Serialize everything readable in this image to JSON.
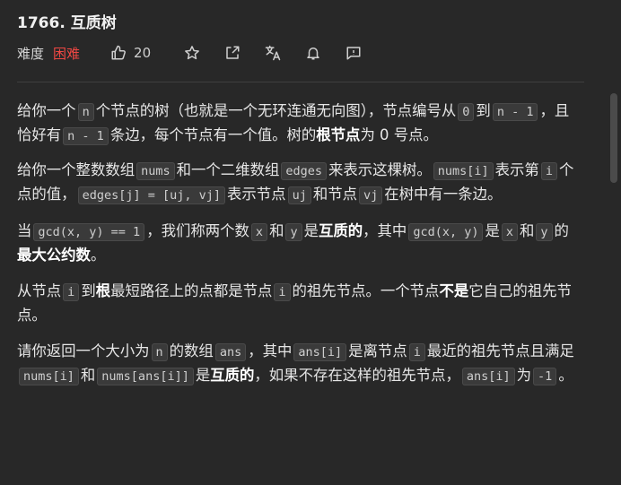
{
  "problem": {
    "title": "1766. 互质树",
    "difficulty_label": "难度",
    "difficulty": "困难",
    "likes": "20"
  },
  "icons": [
    "thumbs-up-icon",
    "star-icon",
    "share-icon",
    "translate-icon",
    "bell-icon",
    "feedback-icon"
  ],
  "colors": {
    "difficulty_hard": "#ef4743",
    "background": "#282828"
  },
  "desc": {
    "p1": {
      "t1": "给你一个",
      "c1": "n",
      "t2": "个节点的树（也就是一个无环连通无向图），节点编号从",
      "c2": "0",
      "t3": "到",
      "c3": "n - 1",
      "t4": "，且恰好有",
      "c4": "n - 1",
      "t5": "条边，每个节点有一个值。树的",
      "b1": "根节点",
      "t6": "为 0 号点。"
    },
    "p2": {
      "t1": "给你一个整数数组",
      "c1": "nums",
      "t2": "和一个二维数组",
      "c2": "edges",
      "t3": "来表示这棵树。",
      "c3": "nums[i]",
      "t4": "表示第",
      "c4": "i",
      "t5": "个点的值，",
      "c5": "edges[j] = [uj, vj]",
      "t6": "表示节点",
      "c6": "uj",
      "t7": "和节点",
      "c7": "vj",
      "t8": "在树中有一条边。"
    },
    "p3": {
      "t1": "当",
      "c1": "gcd(x, y) == 1",
      "t2": "，我们称两个数",
      "c2": "x",
      "t3": "和",
      "c3": "y",
      "t4": "是",
      "b1": "互质的",
      "t5": "，其中",
      "c4": "gcd(x, y)",
      "t6": "是",
      "c5": "x",
      "t7": "和",
      "c6": "y",
      "t8": "的",
      "b2": "最大公约数",
      "t9": "。"
    },
    "p4": {
      "t1": "从节点",
      "c1": "i",
      "t2": "到",
      "b1": "根",
      "t3": "最短路径上的点都是节点",
      "c2": "i",
      "t4": "的祖先节点。一个节点",
      "b2": "不是",
      "t5": "它自己的祖先节点。"
    },
    "p5": {
      "t1": "请你返回一个大小为",
      "c1": "n",
      "t2": "的数组",
      "c2": "ans",
      "t3": "，其中",
      "c3": "ans[i]",
      "t4": "是离节点",
      "c4": "i",
      "t5": "最近的祖先节点且满足",
      "c5": "nums[i]",
      "t6": "和",
      "c6": "nums[ans[i]]",
      "t7": "是",
      "b1": "互质的",
      "t8": "，如果不存在这样的祖先节点，",
      "c7": "ans[i]",
      "t9": "为",
      "c8": "-1",
      "t10": "。"
    }
  }
}
